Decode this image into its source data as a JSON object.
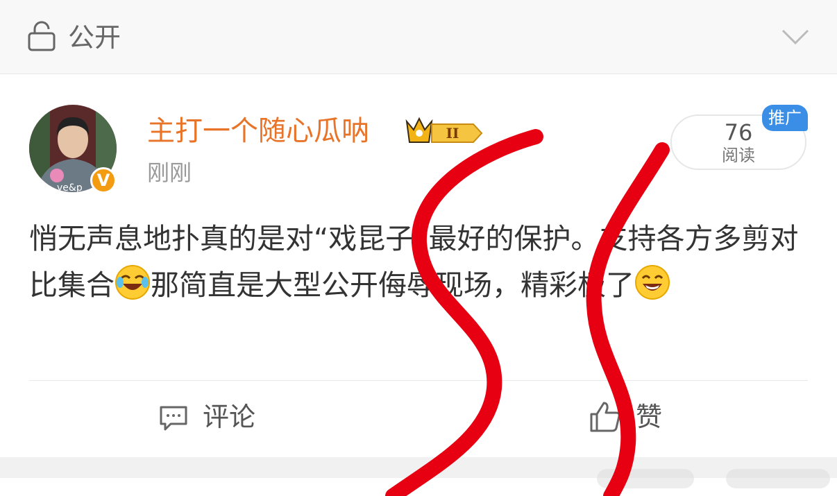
{
  "privacy": {
    "label": "公开",
    "icon": "lock-icon"
  },
  "post": {
    "author": "主打一个随心瓜呐",
    "time": "刚刚",
    "vip_level": "II",
    "reads": {
      "count": "76",
      "label": "阅读"
    },
    "promo_badge": "推广",
    "text_part1": "悄无声息地扑真的是对“戏昆子”最好的保护。支持各方多剪对比集合",
    "text_part2": "那简直是大型公开侮辱现场，精彩极了",
    "emoji_1": "laughing-tears-emoji",
    "emoji_2": "grinning-emoji"
  },
  "actions": {
    "comment": "评论",
    "like": "赞"
  },
  "colors": {
    "username": "#e8742a",
    "promo": "#3a8ee6",
    "verified": "#f39c12",
    "marker": "#e60012"
  }
}
